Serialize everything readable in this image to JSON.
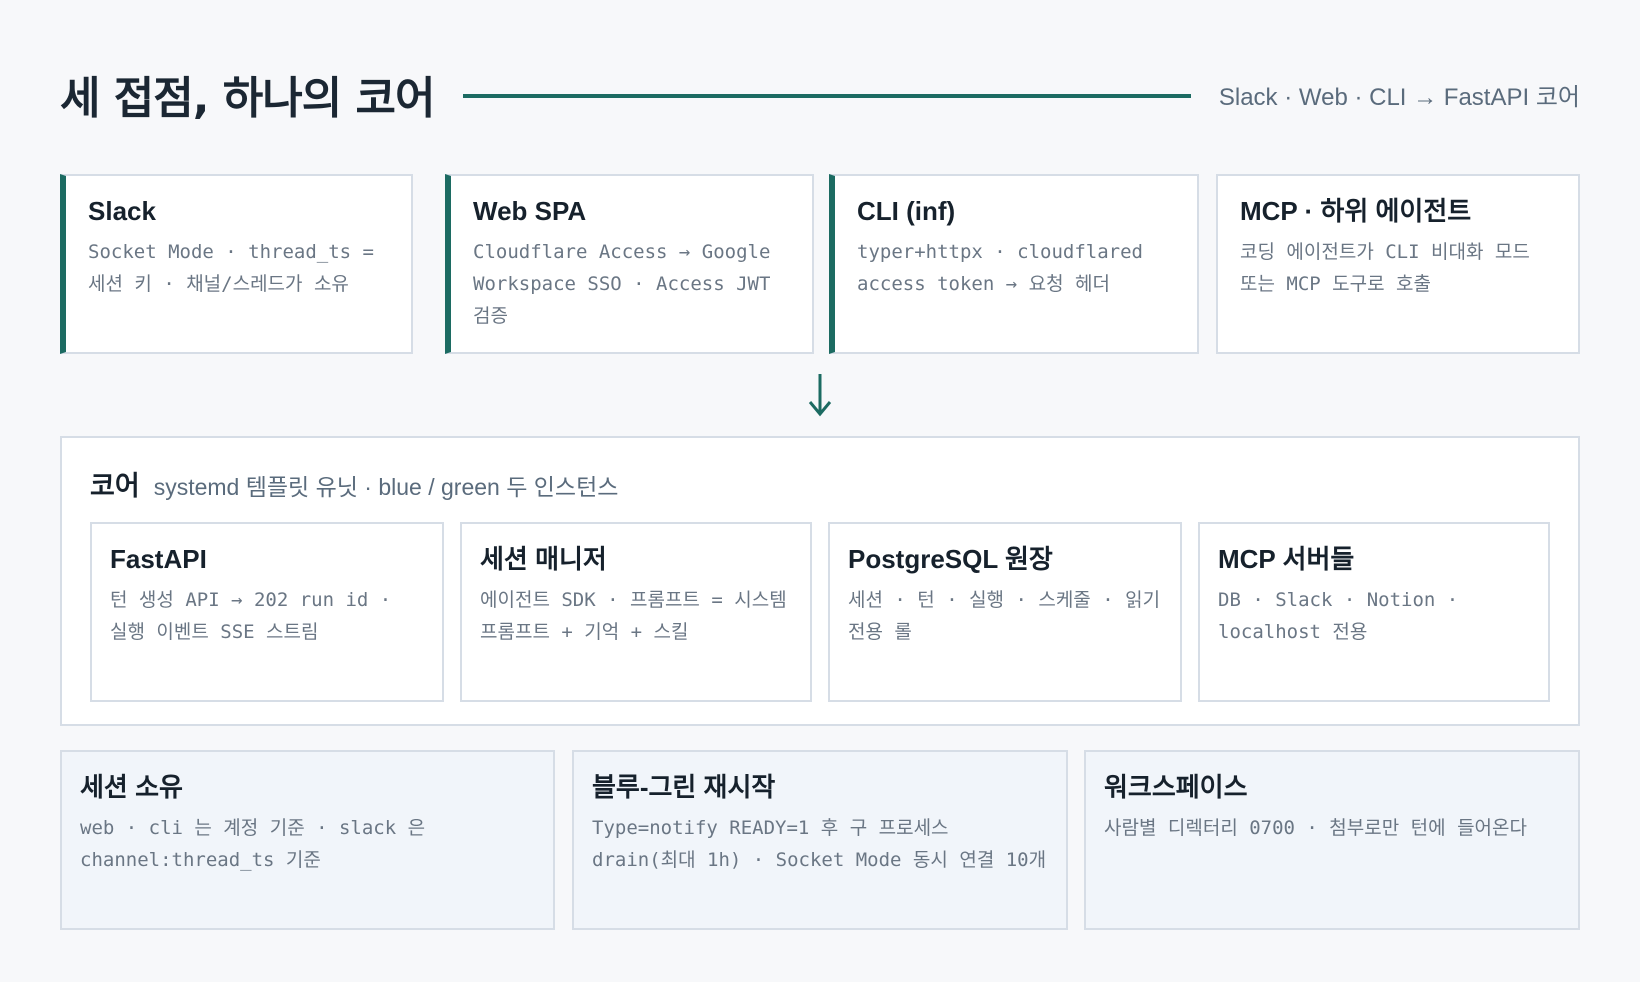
{
  "header": {
    "title": "세 접점, 하나의 코어",
    "subtitle": "Slack · Web · CLI → FastAPI 코어"
  },
  "entry_points": [
    {
      "title": "Slack",
      "desc": "Socket Mode · thread_ts = 세션 키 · 채널/스레드가 소유"
    },
    {
      "title": "Web SPA",
      "desc": "Cloudflare Access → Google Workspace SSO · Access JWT 검증"
    },
    {
      "title": "CLI (inf)",
      "desc": "typer+httpx · cloudflared access token → 요청 헤더"
    },
    {
      "title": "MCP · 하위 에이전트",
      "desc": "코딩 에이전트가 CLI 비대화 모드 또는 MCP 도구로 호출"
    }
  ],
  "arrow_glyph": "↓",
  "core": {
    "label": "코어",
    "subtitle": "systemd 템플릿 유닛 · blue / green 두 인스턴스",
    "components": [
      {
        "title": "FastAPI",
        "desc": "턴 생성 API → 202 run id · 실행 이벤트 SSE 스트림"
      },
      {
        "title": "세션 매니저",
        "desc": "에이전트 SDK · 프롬프트 = 시스템 프롬프트 + 기억 + 스킬"
      },
      {
        "title": "PostgreSQL 원장",
        "desc": "세션 · 턴 · 실행 · 스케줄 · 읽기 전용 롤"
      },
      {
        "title": "MCP 서버들",
        "desc": "DB · Slack · Notion · localhost 전용"
      }
    ]
  },
  "notes": [
    {
      "title": "세션 소유",
      "desc": "web · cli 는 계정 기준 · slack 은 channel:thread_ts 기준"
    },
    {
      "title": "블루-그린 재시작",
      "desc": "Type=notify READY=1 후 구 프로세스 drain(최대 1h) · Socket Mode 동시 연결 10개"
    },
    {
      "title": "워크스페이스",
      "desc": "사람별 디렉터리 0700 · 첨부로만 턴에 들어온다"
    }
  ],
  "colors": {
    "accent": "#1c6b62",
    "border": "#d6dde6",
    "note_bg": "#f1f5fa"
  }
}
